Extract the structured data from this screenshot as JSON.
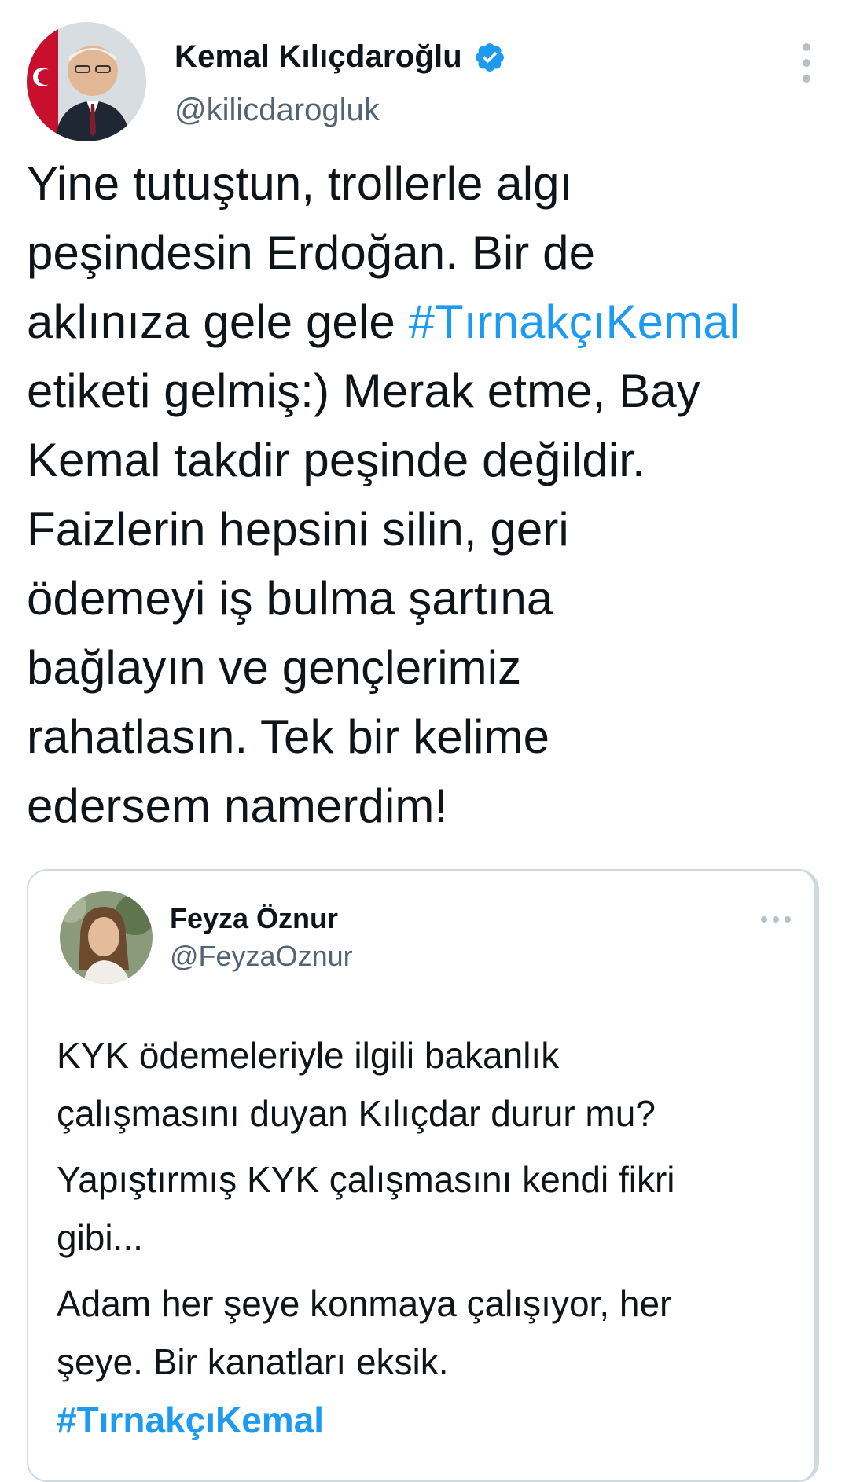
{
  "tweet": {
    "author": {
      "display_name": "Kemal Kılıçdaroğlu",
      "handle": "@kilicdarogluk",
      "verified": true
    },
    "menu_icon": "more-vertical-icon",
    "body_lines": [
      "Yine tutuştun, trollerle algı",
      "peşindesin Erdoğan. Bir de",
      "aklınıza gele gele ",
      "etiketi gelmiş:) Merak etme, Bay",
      "Kemal takdir peşinde değildir.",
      "Faizlerin hepsini silin, geri",
      "ödemeyi iş bulma şartına",
      "bağlayın ve gençlerimiz",
      "rahatlasın. Tek bir kelime",
      "edersem namerdim!"
    ],
    "hashtag": "#TırnakçıKemal"
  },
  "quoted_tweet": {
    "author": {
      "display_name": "Feyza Öznur",
      "handle": "@FeyzaOznur"
    },
    "menu_icon": "more-horizontal-icon",
    "body_lines": [
      "KYK ödemeleriyle ilgili bakanlık",
      "çalışmasını duyan Kılıçdar durur mu?",
      "Yapıştırmış KYK çalışmasını kendi fikri",
      "gibi...",
      "Adam her şeye konmaya çalışıyor, her",
      "şeye. Bir kanatları eksik."
    ],
    "hashtag": "#TırnakçıKemal"
  },
  "colors": {
    "link": "#1d9bf0",
    "secondary_text": "#536471",
    "border": "#cfd9de"
  }
}
